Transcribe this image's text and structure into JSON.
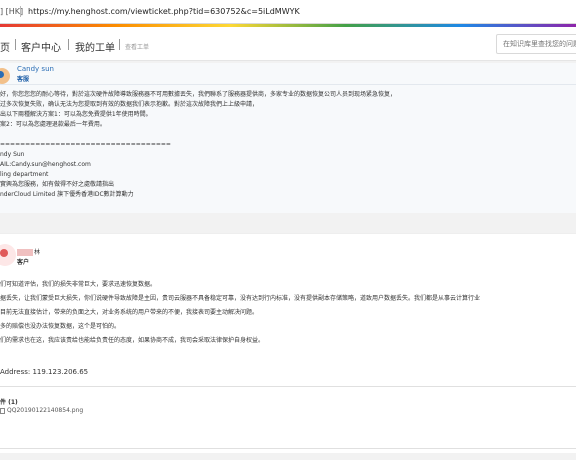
{
  "browser": {
    "site_badge": "] [HK]",
    "url": "https://my.henghost.com/viewticket.php?tid=630752&c=5iLdMWYK"
  },
  "nav": {
    "items": [
      "页",
      "客户中心",
      "我的工单"
    ],
    "crumb": "查看工单",
    "search_placeholder": "在知识库里查找您的问题"
  },
  "staff_message": {
    "name": "Candy sun",
    "role": "客服",
    "lines": [
      "好，你您您您的耐心等待，對於這次硬件故障導致服務器不可用數據丟失，我們聯系了服務器提供商，多家专业的数据恢复公司人员到现场紧急恢复，",
      "过多次恢复失败，确认无法为您提取到有效的数据我们表示抱歉。對於這次故障我們上上級申請，",
      "出以下兩種解決方案1：可以為您免費提供1年使用時間。",
      "案2：可以為您處理退款最后一年費用。",
      "",
      "==================================",
      "ndy Sun",
      "AIL:Candy.sun@henghost.com",
      "ling department",
      "實興為您服務，如有做得不好之處敬請指出",
      "nderCloud Limited 旗下優秀香港IDC數計算動力"
    ]
  },
  "customer_message": {
    "name_suffix": "林",
    "role": "客户",
    "lines": [
      "们可知道评估，我们的损失非常巨大，要求迅速恢复数据。",
      "据丢失，让我们蒙受巨大损失，你们说硬件导致故障是主因，贵司云服器不具备稳定可靠，没有达到行内标准，没有提供副本存储策略，道致用户数据丢失。我们都是从事云计算行业",
      "目前无法直接估计，带来的负面之大，对业务系统的用户带来的不便，我接表司要主动解决问题。",
      "多的赔偿也没办法恢复数据，这个是可怕的。",
      "们的需求也在这，我应该责给也能给负责任的态度，如果协商不成，我司会采取法律保护自身权益。"
    ],
    "ip_label": "Address: 119.123.206.65",
    "attachment_title": "件 (1)",
    "attachment_file": "QQ20190122140854.png"
  }
}
